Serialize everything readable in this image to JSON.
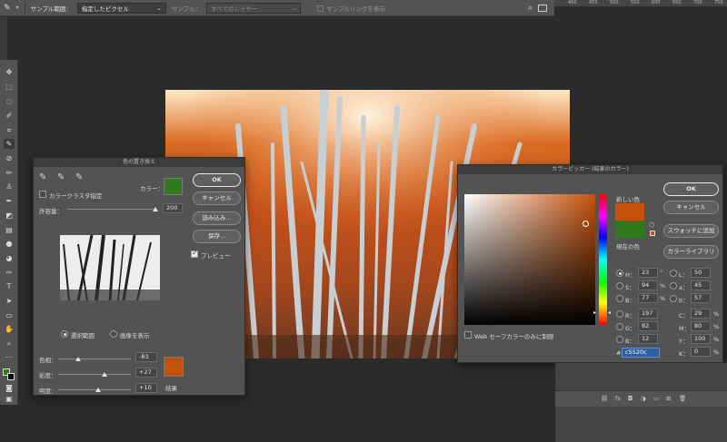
{
  "options_bar": {
    "sample_size_label": "サンプル範囲：",
    "sample_size_value": "指定したピクセル",
    "sample_label": "サンプル：",
    "sample_value": "すべてのレイヤー",
    "show_ring_label": "サンプルリングを表示",
    "icons": [
      "eyedropper-icon",
      "search-icon",
      "workspace-icon"
    ]
  },
  "ruler": {
    "ticks": [
      "400",
      "450",
      "500",
      "550",
      "600",
      "650",
      "700",
      "750"
    ]
  },
  "replace_color": {
    "title": "色の置き換え",
    "color_label": "カラー：",
    "selected_color": "#2e7a1d",
    "localized_clusters_label": "カラークラスタ指定",
    "fuzziness_label": "許容量：",
    "fuzziness_value": "200",
    "fuzziness_fraction": 1.0,
    "ok_label": "OK",
    "cancel_label": "キャンセル",
    "load_label": "読み込み...",
    "save_label": "保存...",
    "preview_label": "プレビュー",
    "preview_checked": true,
    "radio_selection_label": "選択範囲",
    "radio_image_label": "画像を表示",
    "selected_radio": "selection",
    "hue_label": "色相：",
    "hue_value": "-83",
    "hue_fraction": 0.27,
    "saturation_label": "彩度：",
    "saturation_value": "+27",
    "saturation_fraction": 0.64,
    "lightness_label": "明度：",
    "lightness_value": "+10",
    "lightness_fraction": 0.55,
    "result_label": "結果",
    "result_color": "#c5520c"
  },
  "color_picker": {
    "title": "カラーピッカー (結果のカラー)",
    "new_label": "新しい色",
    "current_label": "現在の色",
    "new_color": "#c5520c",
    "current_color": "#2e7a1d",
    "ok_label": "OK",
    "cancel_label": "キャンセル",
    "add_swatch_label": "スウォッチに追加",
    "color_libraries_label": "カラーライブラリ",
    "web_only_label": "Web セーフカラーのみに制限",
    "hsb": [
      {
        "key": "H：",
        "value": "23",
        "unit": "°",
        "selected": true
      },
      {
        "key": "S：",
        "value": "94",
        "unit": "%",
        "selected": false
      },
      {
        "key": "B：",
        "value": "77",
        "unit": "%",
        "selected": false
      }
    ],
    "rgb": [
      {
        "key": "R：",
        "value": "197"
      },
      {
        "key": "G：",
        "value": "82"
      },
      {
        "key": "B：",
        "value": "12"
      }
    ],
    "lab": [
      {
        "key": "L：",
        "value": "50"
      },
      {
        "key": "a：",
        "value": "45"
      },
      {
        "key": "b：",
        "value": "57"
      }
    ],
    "cmyk": [
      {
        "key": "C：",
        "value": "29",
        "unit": "%"
      },
      {
        "key": "M：",
        "value": "80",
        "unit": "%"
      },
      {
        "key": "Y：",
        "value": "100",
        "unit": "%"
      },
      {
        "key": "K：",
        "value": "0",
        "unit": "%"
      }
    ],
    "hex_label": "#",
    "hex_value": "c5520c"
  },
  "layers_panel": {
    "icons": [
      "link-icon",
      "fx-icon",
      "mask-icon",
      "adjustment-icon",
      "folder-icon",
      "new-layer-icon",
      "trash-icon"
    ]
  }
}
